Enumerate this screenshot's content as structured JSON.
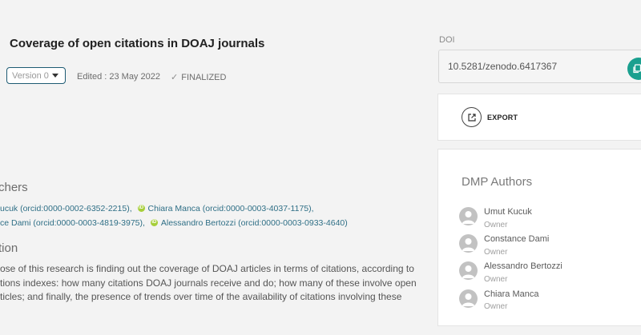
{
  "header": {
    "title": "Coverage of open citations in DOAJ journals",
    "version_select": "Version 0",
    "edited": "Edited : 23 May 2022",
    "status": "FINALIZED"
  },
  "researchers": {
    "heading": "chers",
    "line1": [
      {
        "text": "ucuk (orcid:0000-0002-6352-2215),",
        "icon": false
      },
      {
        "text": "Chiara Manca (orcid:0000-0003-4037-1175),",
        "icon": true
      }
    ],
    "line2": [
      {
        "text": "ce Dami (orcid:0000-0003-4819-3975),",
        "icon": false
      },
      {
        "text": "Alessandro Bertozzi (orcid:0000-0003-0933-4640)",
        "icon": true
      }
    ]
  },
  "description": {
    "heading": "tion",
    "lines": [
      "ose of this research is finding out the coverage of DOAJ articles in terms of citations, according to",
      "tions indexes: how many citations DOAJ journals receive and do; how many of these involve open",
      "ticles; and finally, the presence of trends over time of the availability of citations involving these"
    ]
  },
  "doi": {
    "label": "DOI",
    "value": "10.5281/zenodo.6417367",
    "copy_icon": "copy-icon"
  },
  "export": {
    "label": "EXPORT",
    "icon": "external-link-icon"
  },
  "dmp_authors": {
    "title": "DMP Authors",
    "authors": [
      {
        "name": "Umut Kucuk",
        "role": "Owner"
      },
      {
        "name": "Constance Dami",
        "role": "Owner"
      },
      {
        "name": "Alessandro Bertozzi",
        "role": "Owner"
      },
      {
        "name": "Chiara Manca",
        "role": "Owner"
      }
    ]
  },
  "colors": {
    "accent_teal": "#1aa08f",
    "link": "#2f6f86",
    "orcid_green": "#a6ce39",
    "select_border": "#1e5b73"
  }
}
